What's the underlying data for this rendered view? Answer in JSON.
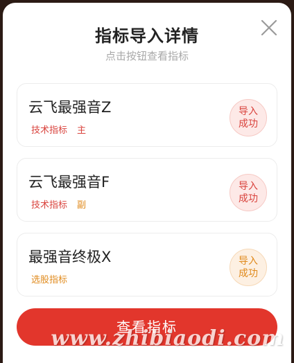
{
  "dialog": {
    "title": "指标导入详情",
    "subtitle": "点击按钮查看指标",
    "close_icon": "close-icon"
  },
  "indicators": [
    {
      "name": "云飞最强音Z",
      "tags": [
        {
          "label": "技术指标",
          "color": "#d9433d"
        },
        {
          "label": "主",
          "color": "#d9433d"
        }
      ],
      "status_line1": "导入",
      "status_line2": "成功",
      "status_color": "#d9433d"
    },
    {
      "name": "云飞最强音F",
      "tags": [
        {
          "label": "技术指标",
          "color": "#d9433d"
        },
        {
          "label": "副",
          "color": "#e08a1c"
        }
      ],
      "status_line1": "导入",
      "status_line2": "成功",
      "status_color": "#d9433d"
    },
    {
      "name": "最强音终极X",
      "tags": [
        {
          "label": "选股指标",
          "color": "#e08a1c"
        }
      ],
      "status_line1": "导入",
      "status_line2": "成功",
      "status_color": "#e08a1c"
    }
  ],
  "primary_button": {
    "label": "查看指标",
    "color": "#e2362c"
  },
  "watermark": {
    "text": "www.zhibiaodi.com"
  }
}
